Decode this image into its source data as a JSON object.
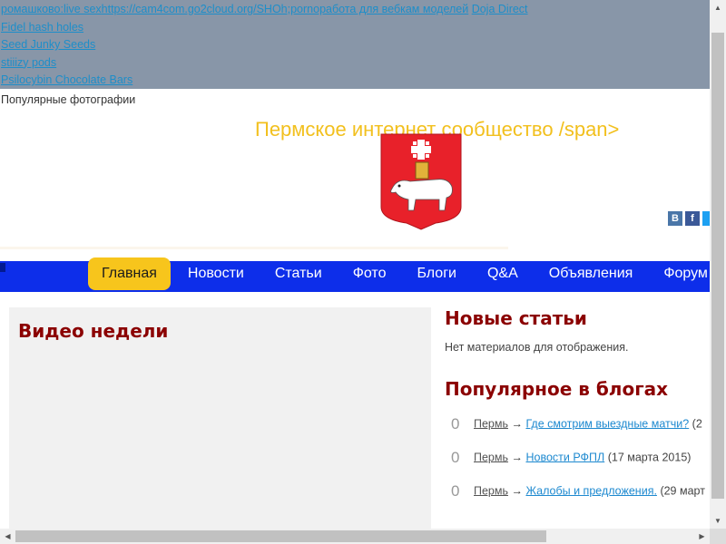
{
  "spam_links": {
    "row1": [
      "ромашково:live sex",
      "https://cam4com.go2cloud.org/SHOh;",
      "pornoработа для вебкам моделей",
      "Doja Direct"
    ],
    "row2": "Fidel hash holes",
    "row3": "Seed Junky Seeds",
    "row4": "stiiizy pods",
    "row5": "Psilocybin Chocolate Bars"
  },
  "popular_photos": "Популярные фотографии",
  "site_title": "Пермское интернет сообщество /span>",
  "social": [
    "vk-icon",
    "facebook-icon",
    "twitter-icon"
  ],
  "colors": {
    "nav": "#0d2eea",
    "nav_active": "#f7c51c",
    "title": "#f2c01e",
    "heading": "#8b0000",
    "link": "#1f8ad0"
  },
  "nav": {
    "items": [
      "Главная",
      "Новости",
      "Статьи",
      "Фото",
      "Блоги",
      "Q&A",
      "Объявления",
      "Форум"
    ],
    "active": "Главная"
  },
  "video": {
    "title": "Видео недели"
  },
  "new_articles": {
    "title": "Новые статьи",
    "empty": "Нет материалов для отображения."
  },
  "blogs": {
    "title": "Популярное в блогах",
    "items": [
      {
        "count": "0",
        "author": "Пермь",
        "title": "Где смотрим выездные матчи?",
        "date": "(2"
      },
      {
        "count": "0",
        "author": "Пермь",
        "title": "Новости РФПЛ",
        "date": "(17 марта 2015)"
      },
      {
        "count": "0",
        "author": "Пермь",
        "title": "Жалобы и предложения.",
        "date": "(29 март"
      }
    ]
  }
}
